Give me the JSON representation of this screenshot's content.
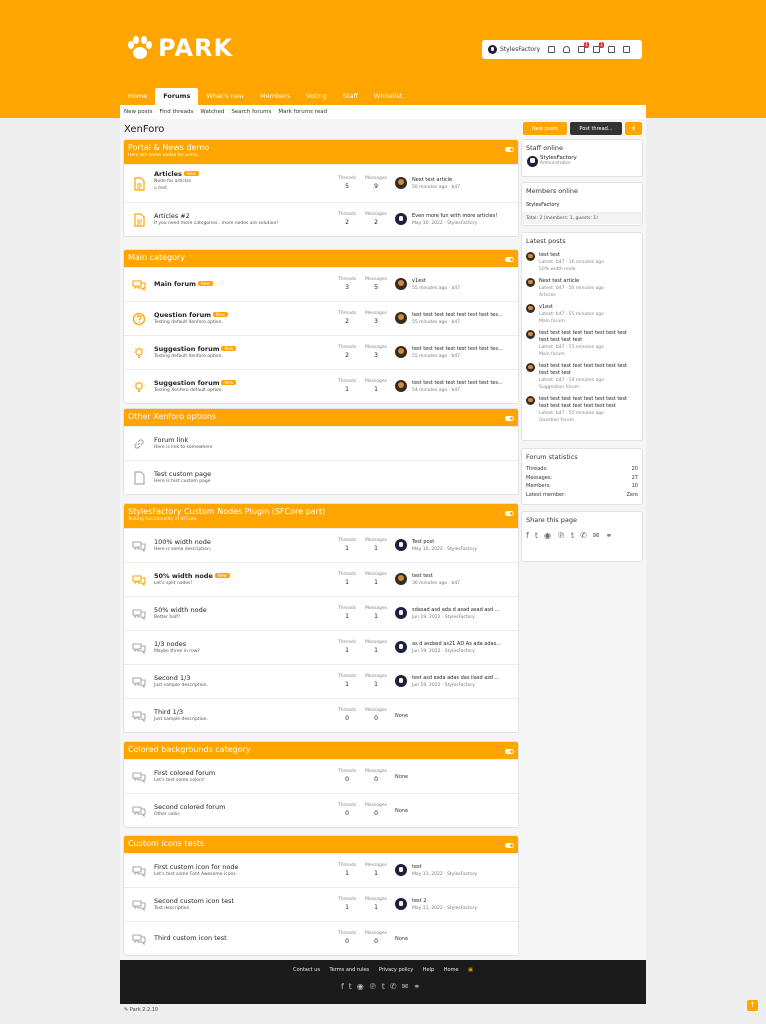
{
  "brand": {
    "name": "PARK",
    "accent": "#ffa500",
    "paw_icon": "paw-icon"
  },
  "userbar": {
    "username": "StylesFactory",
    "alerts_badge": "1",
    "convo_badge": "1"
  },
  "nav": {
    "tabs": [
      {
        "label": "Home"
      },
      {
        "label": "Forums"
      },
      {
        "label": "What's new"
      },
      {
        "label": "Members"
      },
      {
        "label": "Voting"
      },
      {
        "label": "Staff"
      },
      {
        "label": "Whitelist"
      }
    ]
  },
  "subnav": {
    "items": [
      {
        "label": "New posts"
      },
      {
        "label": "Find threads"
      },
      {
        "label": "Watched"
      },
      {
        "label": "Search forums"
      },
      {
        "label": "Mark forums read"
      }
    ]
  },
  "page_title": "XenForo",
  "buttons": {
    "new_posts": "New posts",
    "post_thread": "Post thread..."
  },
  "stat_labels": {
    "threads": "Threads",
    "messages": "Messages"
  },
  "categories": [
    {
      "title": "Portal & News demo",
      "desc": "Here are some nodes for portal",
      "nodes": [
        {
          "title": "Articles",
          "new": "New",
          "desc": "Node for articles",
          "sub": "test",
          "threads": "5",
          "messages": "9",
          "last_title": "Next test article",
          "last_meta": "50 minutes ago · b47",
          "icon": "article-icon"
        },
        {
          "title": "Articles #2",
          "new": "",
          "desc": "If you need more categories.. more nodes are solution!",
          "threads": "2",
          "messages": "2",
          "last_title": "Even more fun with more articles!",
          "last_meta": "May 10, 2022 · StylesFactory",
          "icon": "article-icon"
        }
      ]
    },
    {
      "title": "Main category",
      "desc": "",
      "nodes": [
        {
          "title": "Main forum",
          "new": "New",
          "desc": "",
          "threads": "3",
          "messages": "5",
          "last_title": "v1est",
          "last_meta": "55 minutes ago · b47",
          "icon": "comments-icon"
        },
        {
          "title": "Question forum",
          "new": "New",
          "desc": "Testing default Xenforo option.",
          "threads": "2",
          "messages": "3",
          "last_title": "test test test test test test test tes...",
          "last_meta": "55 minutes ago · b47",
          "icon": "question-icon"
        },
        {
          "title": "Suggestion forum",
          "new": "New",
          "desc": "Testing default Xenforo option.",
          "threads": "2",
          "messages": "3",
          "last_title": "test test test test test test test tes...",
          "last_meta": "55 minutes ago · b47",
          "icon": "lightbulb-icon"
        },
        {
          "title": "Suggestion forum",
          "new": "New",
          "desc": "Testing Xenforo default option.",
          "threads": "1",
          "messages": "1",
          "last_title": "test test test test test test test tes...",
          "last_meta": "54 minutes ago · b47",
          "icon": "lightbulb-icon"
        }
      ]
    },
    {
      "title": "Other Xenforo options",
      "desc": "",
      "nodes": [
        {
          "title": "Forum link",
          "new": "",
          "desc": "Here is link to somewhere",
          "icon": "link-icon"
        },
        {
          "title": "Test custom page",
          "new": "",
          "desc": "Here is test custom page",
          "icon": "page-icon"
        }
      ]
    },
    {
      "title": "StylesFactory Custom Nodes Plugin (SFCore part)",
      "desc": "Testing functionality of SFCore",
      "nodes": [
        {
          "title": "100% width node",
          "new": "",
          "desc": "Here is some description.",
          "threads": "1",
          "messages": "1",
          "last_title": "Test post",
          "last_meta": "May 10, 2022 · StylesFactory",
          "icon": "comments-icon"
        },
        {
          "title": "50% width node",
          "new": "New",
          "desc": "Let's split nodes!",
          "threads": "1",
          "messages": "1",
          "last_title": "test test",
          "last_meta": "36 minutes ago · b47",
          "icon": "comments-icon"
        },
        {
          "title": "50% width node",
          "new": "",
          "desc": "Better half?",
          "threads": "1",
          "messages": "1",
          "last_title": "sdasad asd ada d asad asad asd ...",
          "last_meta": "Jun 19, 2022 · StylesFactory",
          "icon": "comments-icon"
        },
        {
          "title": "1/3 nodes",
          "new": "",
          "desc": "Maybe three in row?",
          "threads": "1",
          "messages": "1",
          "last_title": "as d asdasd as21 AD As ada adas...",
          "last_meta": "Jun 19, 2022 · StylesFactory",
          "icon": "comments-icon"
        },
        {
          "title": "Second 1/3",
          "new": "",
          "desc": "Just sample description.",
          "threads": "1",
          "messages": "1",
          "last_title": "test asd asda adas das ilasd asd ...",
          "last_meta": "Jun 19, 2022 · StylesFactory",
          "icon": "comments-icon"
        },
        {
          "title": "Third 1/3",
          "new": "",
          "desc": "Just sample description.",
          "threads": "0",
          "messages": "0",
          "last_title": "",
          "last_meta": "",
          "none": "None",
          "icon": "comments-icon"
        }
      ]
    },
    {
      "title": "Colored backgrounds category",
      "desc": "",
      "nodes": [
        {
          "title": "First colored forum",
          "new": "",
          "desc": "Let's test some colors!",
          "threads": "0",
          "messages": "0",
          "none": "None",
          "icon": "comments-icon"
        },
        {
          "title": "Second colored forum",
          "new": "",
          "desc": "Other color.",
          "threads": "0",
          "messages": "0",
          "none": "None",
          "icon": "comments-icon"
        }
      ]
    },
    {
      "title": "Custom icons tests",
      "desc": "",
      "nodes": [
        {
          "title": "First custom icon for node",
          "new": "",
          "desc": "Let's test some Font Awesome icons.",
          "threads": "1",
          "messages": "1",
          "last_title": "test",
          "last_meta": "May 11, 2022 · StylesFactory",
          "icon": "comments-icon"
        },
        {
          "title": "Second custom icon test",
          "new": "",
          "desc": "Test description.",
          "threads": "1",
          "messages": "1",
          "last_title": "test 2",
          "last_meta": "May 11, 2022 · StylesFactory",
          "icon": "comments-icon"
        },
        {
          "title": "Third custom icon test",
          "new": "",
          "desc": "",
          "threads": "0",
          "messages": "0",
          "none": "None",
          "icon": "comments-icon"
        }
      ]
    }
  ],
  "sidebar": {
    "staff": {
      "title": "Staff online",
      "name": "StylesFactory",
      "role": "Administrator"
    },
    "members": {
      "title": "Members online",
      "name": "StylesFactory",
      "total": "Total: 2 (members: 1, guests: 1)"
    },
    "latest": {
      "title": "Latest posts",
      "posts": [
        {
          "title": "test test",
          "meta": "Latest: b47 · 36 minutes ago",
          "forum": "50% width node"
        },
        {
          "title": "Next test article",
          "meta": "Latest: b47 · 50 minutes ago",
          "forum": "Articles"
        },
        {
          "title": "v1est",
          "meta": "Latest: b47 · 55 minutes ago",
          "forum": "Main forum"
        },
        {
          "title": "test test test test test test test test test test test test",
          "meta": "Latest: b47 · 55 minutes ago",
          "forum": "Main forum"
        },
        {
          "title": "test test test test test test test test test test test",
          "meta": "Latest: b47 · 54 minutes ago",
          "forum": "Suggestion forum"
        },
        {
          "title": "test test test test test test test test test test test test test test test",
          "meta": "Latest: b47 · 55 minutes ago",
          "forum": "Question forum"
        }
      ]
    },
    "stats": {
      "title": "Forum statistics",
      "rows": [
        {
          "label": "Threads:",
          "value": "20"
        },
        {
          "label": "Messages:",
          "value": "27"
        },
        {
          "label": "Members:",
          "value": "10"
        },
        {
          "label": "Latest member:",
          "value": "Zero"
        }
      ]
    },
    "share": {
      "title": "Share this page",
      "icons": [
        "facebook-icon",
        "twitter-icon",
        "reddit-icon",
        "pinterest-icon",
        "tumblr-icon",
        "whatsapp-icon",
        "email-icon",
        "link-icon"
      ]
    }
  },
  "footer": {
    "links": [
      "Contact us",
      "Terms and rules",
      "Privacy policy",
      "Help",
      "Home"
    ]
  },
  "copyright": "Park 2.2.10"
}
